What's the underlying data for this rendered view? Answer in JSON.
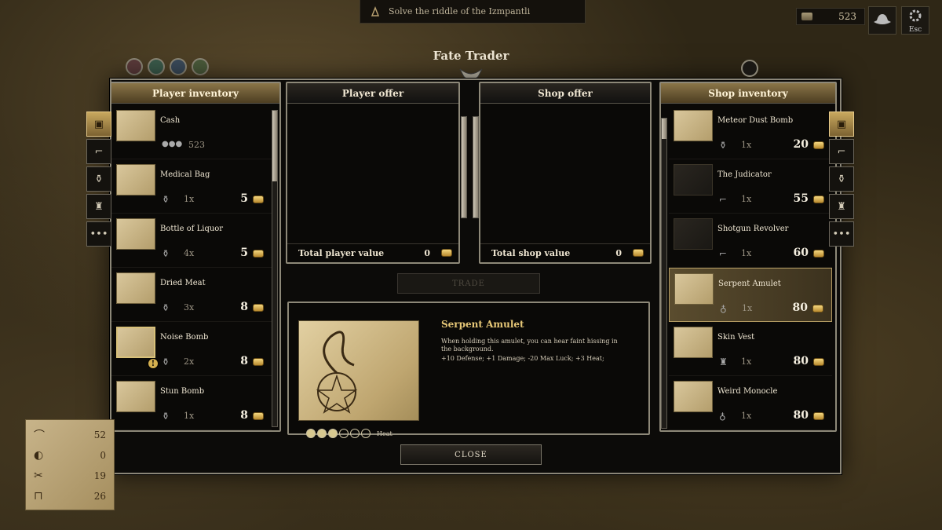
{
  "quest": {
    "text": "Solve the riddle of the Izmpantli"
  },
  "top_right": {
    "cash": "523",
    "esc_label": "Esc"
  },
  "window": {
    "title": "Fate Trader"
  },
  "panels": {
    "player_inventory": "Player inventory",
    "player_offer": "Player offer",
    "shop_offer": "Shop offer",
    "shop_inventory": "Shop inventory"
  },
  "player_items": [
    {
      "name": "Cash",
      "qty": "523",
      "price": ""
    },
    {
      "name": "Medical Bag",
      "qty": "1x",
      "price": "5"
    },
    {
      "name": "Bottle of Liquor",
      "qty": "4x",
      "price": "5"
    },
    {
      "name": "Dried Meat",
      "qty": "3x",
      "price": "8"
    },
    {
      "name": "Noise Bomb",
      "qty": "2x",
      "price": "8"
    },
    {
      "name": "Stun Bomb",
      "qty": "1x",
      "price": "8"
    }
  ],
  "shop_items": [
    {
      "name": "Meteor Dust Bomb",
      "qty": "1x",
      "price": "20"
    },
    {
      "name": "The Judicator",
      "qty": "1x",
      "price": "55"
    },
    {
      "name": "Shotgun Revolver",
      "qty": "1x",
      "price": "60"
    },
    {
      "name": "Serpent Amulet",
      "qty": "1x",
      "price": "80"
    },
    {
      "name": "Skin Vest",
      "qty": "1x",
      "price": "80"
    },
    {
      "name": "Weird Monocle",
      "qty": "1x",
      "price": "80"
    }
  ],
  "offers": {
    "player_total_label": "Total player value",
    "player_total": "0",
    "shop_total_label": "Total shop value",
    "shop_total": "0"
  },
  "buttons": {
    "trade": "TRADE",
    "close": "CLOSE"
  },
  "detail": {
    "title": "Serpent Amulet",
    "description": "When holding this amulet, you can hear faint hissing in the background.",
    "stats": "+10 Defense; +1 Damage; -20 Max Luck; +3 Heat;",
    "heat_label": "Heat",
    "heat_level": 3,
    "heat_max": 6
  },
  "stats_panel": [
    {
      "icon": "hat-icon",
      "value": "52"
    },
    {
      "icon": "bread-icon",
      "value": "0"
    },
    {
      "icon": "tools-icon",
      "value": "19"
    },
    {
      "icon": "tombstone-icon",
      "value": "26"
    }
  ],
  "colors": {
    "gold": "#e6c777",
    "frame": "#8d8878",
    "selected": "#b39b62"
  }
}
